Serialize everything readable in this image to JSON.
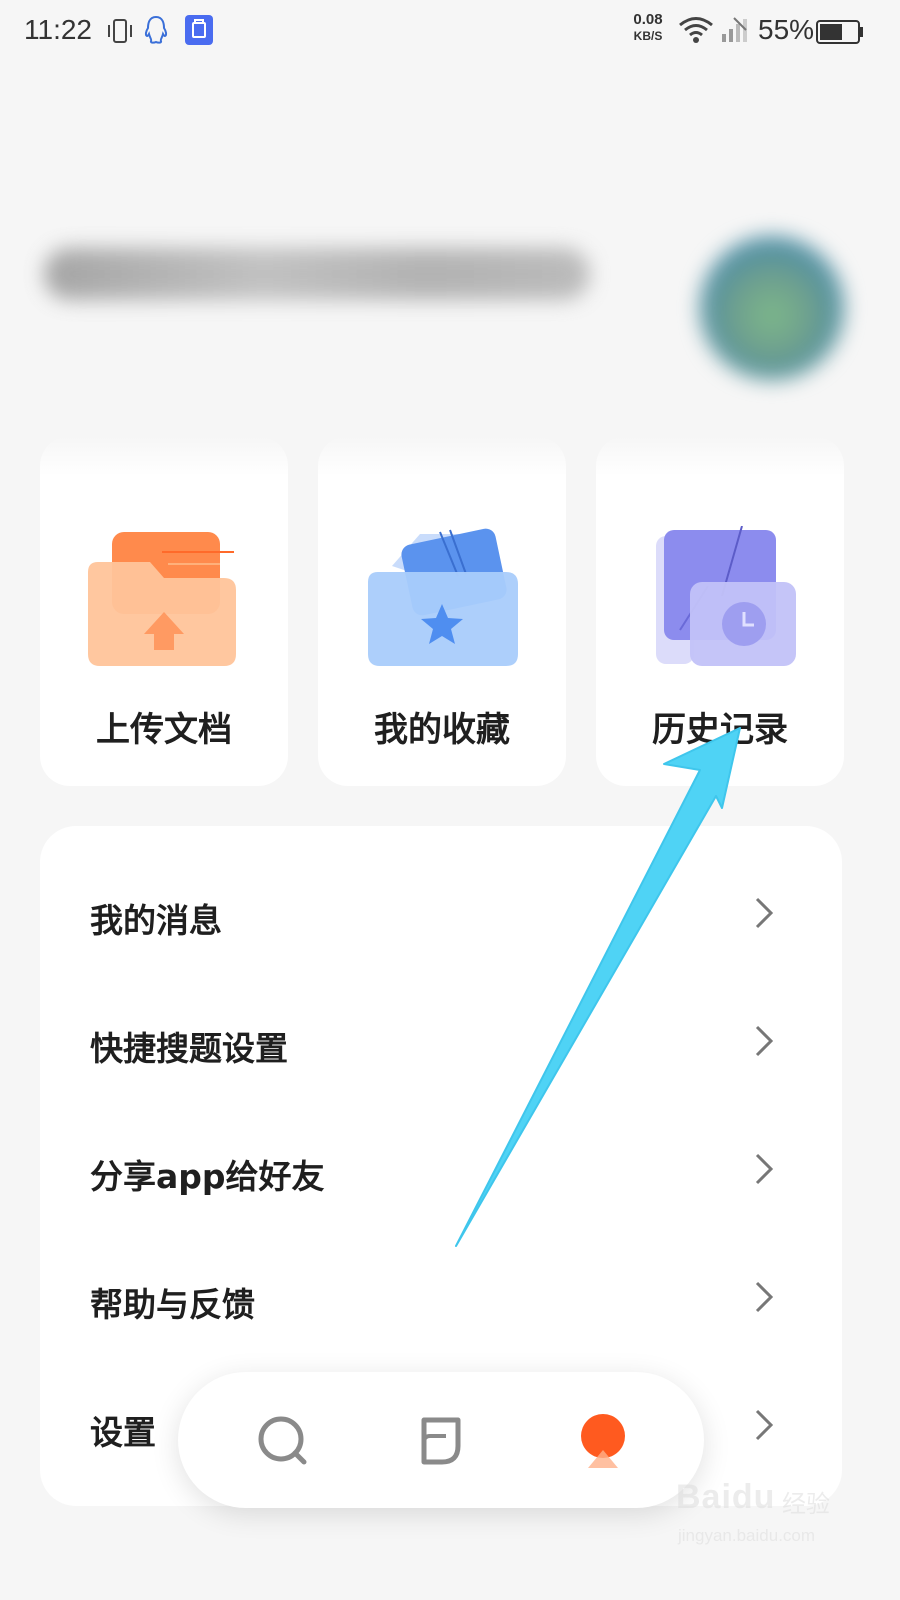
{
  "status_bar": {
    "time": "11:22",
    "net_speed_value": "0.08",
    "net_speed_unit": "KB/S",
    "battery": "55%",
    "icons": [
      "vibrate-icon",
      "qq-icon",
      "app-notification-icon",
      "wifi-icon",
      "signal-icon",
      "battery-icon"
    ]
  },
  "profile": {
    "name": "",
    "name_blurred": true,
    "avatar_blurred": true
  },
  "quick_actions": [
    {
      "label": "上传文档",
      "icon": "upload-folder-icon",
      "color": "#ff9a5c"
    },
    {
      "label": "我的收藏",
      "icon": "favorite-folder-icon",
      "color": "#6aa6f5"
    },
    {
      "label": "历史记录",
      "icon": "history-folder-icon",
      "color": "#8f8ff2"
    }
  ],
  "menu": [
    {
      "label": "我的消息"
    },
    {
      "label": "快捷搜题设置"
    },
    {
      "label": "分享app给好友"
    },
    {
      "label": "帮助与反馈"
    },
    {
      "label": "设置"
    }
  ],
  "bottom_nav": [
    {
      "name": "search",
      "icon": "search-icon"
    },
    {
      "name": "documents",
      "icon": "document-icon"
    },
    {
      "name": "profile",
      "icon": "profile-icon",
      "active": true
    }
  ],
  "annotation": {
    "color": "#4fd3f5",
    "points_to": "历史记录"
  },
  "watermark": {
    "brand": "Baidu",
    "brand_cn": "经验",
    "url": "jingyan.baidu.com"
  },
  "colors": {
    "background": "#f6f6f6",
    "card": "#ffffff",
    "accent": "#ff5a1f"
  }
}
